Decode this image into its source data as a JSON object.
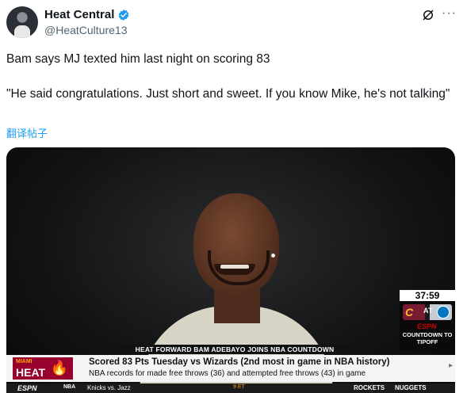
{
  "post": {
    "display_name": "Heat Central",
    "handle": "@HeatCulture13",
    "text_line1": "Bam says MJ texted him last night on scoring 83",
    "text_line2": "\"He said congratulations. Just short and sweet. If you know Mike, he's not talking\"",
    "translate_label": "翻译帖子"
  },
  "video": {
    "clock": "37:59",
    "matchup_at": "AT",
    "espn_mini": "ESPN",
    "countdown_label": "COUNTDOWN TO TIPOFF",
    "lower_third": "HEAT FORWARD BAM ADEBAYO JOINS NBA COUNTDOWN",
    "team_city": "MIAMI",
    "team_name": "HEAT",
    "stat_main": "Scored 83 Pts Tuesday vs Wizards (2nd most in game in NBA history)",
    "stat_sub": "NBA records for made free throws (36) and attempted free throws (43) in game",
    "ticker_bottom": {
      "network": "ESPN",
      "league": "NBA",
      "matchup": "Knicks vs. Jazz",
      "time": "9 ET",
      "league2": "NBA",
      "matchup2": "ROCKETS",
      "matchup3": "NUGGETS"
    }
  },
  "icons": [
    "verified-badge-icon",
    "grok-icon",
    "more-icon"
  ],
  "colors": {
    "accent": "#1d9bf0",
    "heat_red": "#98002e",
    "heat_gold": "#f9a01b"
  }
}
